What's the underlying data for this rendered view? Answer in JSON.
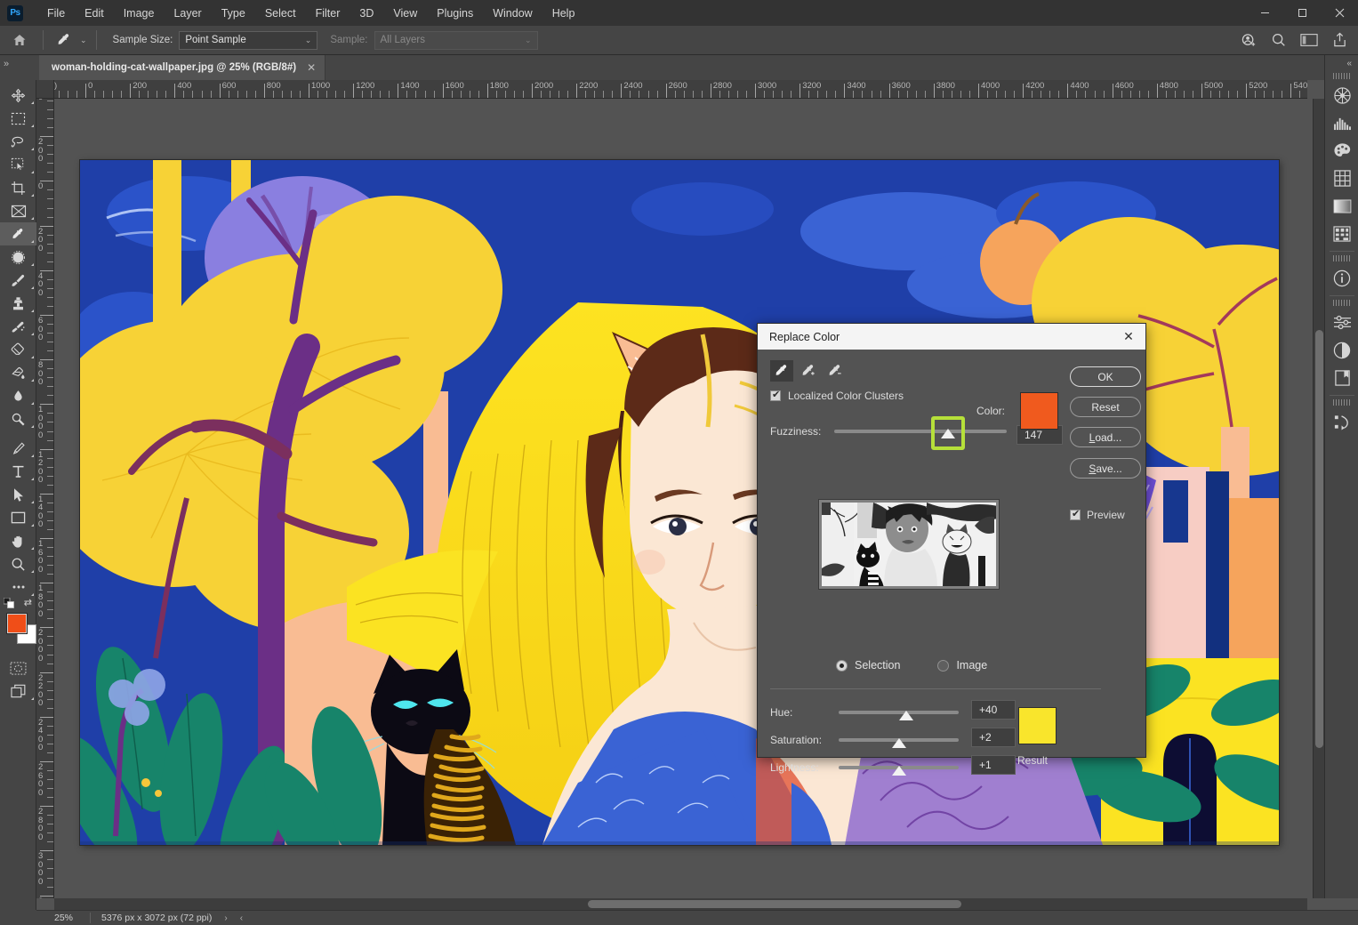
{
  "app": {
    "name": "Adobe Photoshop",
    "logo_text": "Ps"
  },
  "menubar": {
    "items": [
      {
        "label": "File"
      },
      {
        "label": "Edit"
      },
      {
        "label": "Image"
      },
      {
        "label": "Layer"
      },
      {
        "label": "Type"
      },
      {
        "label": "Select"
      },
      {
        "label": "Filter"
      },
      {
        "label": "3D"
      },
      {
        "label": "View"
      },
      {
        "label": "Plugins"
      },
      {
        "label": "Window"
      },
      {
        "label": "Help"
      }
    ]
  },
  "window_controls": {
    "minimize": "—",
    "maximize": "□",
    "close": "✕"
  },
  "options_bar": {
    "home_icon": "home-icon",
    "tool_icon": "eyedropper-icon",
    "tool_preset_caret": "⌄",
    "sample_size_label": "Sample Size:",
    "sample_size_value": "Point Sample",
    "sample_label": "Sample:",
    "sample_value": "All Layers",
    "caret": "⌄",
    "right_icons": [
      {
        "name": "share-user-icon"
      },
      {
        "name": "search-icon"
      },
      {
        "name": "workspace-icon"
      },
      {
        "name": "export-icon"
      }
    ]
  },
  "tab_bar": {
    "collapse_left": "»",
    "collapse_right": "«",
    "document_tab": "woman-holding-cat-wallpaper.jpg @ 25% (RGB/8#)",
    "close_glyph": "✕"
  },
  "toolbar": {
    "tools": [
      {
        "name": "move-tool",
        "selected": false
      },
      {
        "name": "rectangular-marquee-tool",
        "selected": false
      },
      {
        "name": "lasso-tool",
        "selected": false
      },
      {
        "name": "object-selection-tool",
        "selected": false
      },
      {
        "name": "crop-tool",
        "selected": false
      },
      {
        "name": "frame-tool",
        "selected": false
      },
      {
        "name": "eyedropper-tool",
        "selected": true
      },
      {
        "name": "spot-healing-brush-tool",
        "selected": false
      },
      {
        "name": "brush-tool",
        "selected": false
      },
      {
        "name": "clone-stamp-tool",
        "selected": false
      },
      {
        "name": "history-brush-tool",
        "selected": false
      },
      {
        "name": "eraser-tool",
        "selected": false
      },
      {
        "name": "gradient-tool",
        "selected": false
      },
      {
        "name": "blur-tool",
        "selected": false
      },
      {
        "name": "dodge-tool",
        "selected": false
      },
      {
        "name": "pen-tool",
        "selected": false
      },
      {
        "name": "type-tool",
        "selected": false
      },
      {
        "name": "path-selection-tool",
        "selected": false
      },
      {
        "name": "rectangle-tool",
        "selected": false
      },
      {
        "name": "hand-tool",
        "selected": false
      },
      {
        "name": "zoom-tool",
        "selected": false
      },
      {
        "name": "edit-toolbar-tool",
        "selected": false
      }
    ],
    "foreground_color": "#f04e18",
    "background_color": "#ffffff",
    "swap_glyph": "⇄",
    "quick_mask": "quick-mask-icon",
    "screen_mode": "screen-mode-icon"
  },
  "right_dock": {
    "collapse_glyph": "«",
    "icons": [
      {
        "name": "color-wheel-icon"
      },
      {
        "name": "histogram-icon"
      },
      {
        "name": "swatches-palette-icon"
      },
      {
        "name": "grid-pattern-icon"
      },
      {
        "name": "gradients-icon"
      },
      {
        "name": "patterns-icon"
      },
      {
        "name": "info-icon"
      },
      {
        "name": "adjustments-icon"
      },
      {
        "name": "contrast-halfmoon-icon"
      },
      {
        "name": "libraries-icon"
      },
      {
        "name": "history-icon"
      }
    ]
  },
  "rulers": {
    "unit": "px",
    "h_labels": [
      "0",
      "200",
      "400",
      "600",
      "800",
      "1000",
      "1200",
      "1400",
      "1600",
      "1800",
      "2000",
      "2200",
      "2400",
      "2600",
      "2800",
      "3000",
      "3200",
      "3400",
      "3600",
      "3800",
      "4000",
      "4200",
      "4400",
      "4600",
      "4800",
      "5000",
      "5200",
      "540"
    ],
    "v_labels": [
      "0",
      "200",
      "0",
      "200",
      "400",
      "600",
      "800",
      "1000",
      "1200",
      "1400",
      "1600",
      "1800",
      "2000",
      "2200",
      "2400",
      "2600",
      "2800",
      "3000",
      "320"
    ]
  },
  "status_bar": {
    "zoom": "25%",
    "doc_info": "5376 px x 3072 px (72 ppi)",
    "arrow_right": "›",
    "arrow_left": "‹"
  },
  "dialog": {
    "title": "Replace Color",
    "close_glyph": "✕",
    "eyedroppers": [
      {
        "name": "eyedropper-sample-icon",
        "active": true
      },
      {
        "name": "eyedropper-add-icon",
        "active": false
      },
      {
        "name": "eyedropper-subtract-icon",
        "active": false
      }
    ],
    "localized_clusters_label": "Localized Color Clusters",
    "localized_clusters_checked": true,
    "fuzziness_label": "Fuzziness:",
    "fuzziness_value": "147",
    "fuzziness_percent": 66,
    "color_label": "Color:",
    "color_swatch": "#f05a1e",
    "buttons": [
      {
        "label": "OK",
        "name": "ok-button"
      },
      {
        "label": "Reset",
        "name": "reset-button"
      },
      {
        "label": "Load...",
        "name": "load-button"
      },
      {
        "label": "Save...",
        "name": "save-button"
      }
    ],
    "preview_label": "Preview",
    "preview_checked": true,
    "view_modes": [
      {
        "label": "Selection",
        "selected": true
      },
      {
        "label": "Image",
        "selected": false
      }
    ],
    "adjustments": [
      {
        "label": "Hue:",
        "value": "+40",
        "percent": 56
      },
      {
        "label": "Saturation:",
        "value": "+2",
        "percent": 50
      },
      {
        "label": "Lightness:",
        "value": "+1",
        "percent": 50
      }
    ],
    "result_label": "Result",
    "result_swatch": "#f9e52c"
  },
  "artwork": {
    "description": "Illustration of a woman with long yellow hair wearing cat ears, holding a black cat, in a stylized forest with yellow and purple trees against a blue sky",
    "palette": {
      "sky_blue": "#1f3fa8",
      "deep_blue": "#2b53c9",
      "tree_yellow": "#f7d236",
      "bright_yellow": "#fbe322",
      "purple": "#8a7fe0",
      "trunk_purple": "#6b2f86",
      "skin": "#fbe7d4",
      "hair_brown": "#5c2a18",
      "peach": "#f9bc93",
      "teal": "#17846a",
      "cat_black": "#0c0a14",
      "cat_eye": "#4fe6ee",
      "dress_blue": "#3a63d4",
      "coral": "#e2593a",
      "pink": "#f7cdc4"
    }
  }
}
